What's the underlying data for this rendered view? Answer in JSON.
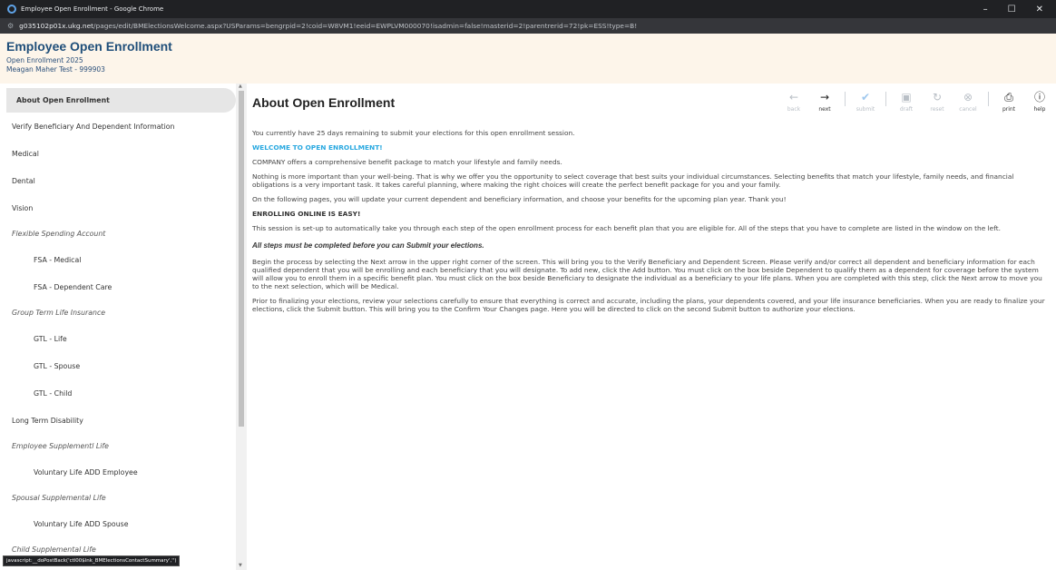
{
  "browser": {
    "window_title": "Employee Open Enrollment - Google Chrome",
    "url_host": "g035102p01x.ukg.net",
    "url_path": "/pages/edit/BMElectionsWelcome.aspx?USParams=bengrpid=2!coid=W8VM1!eeid=EWPLVM000070!isadmin=false!masterid=2!parentrerid=72!pk=ESS!type=B!",
    "status_link": "javascript:__doPostBack('ctl00$lnk_BMElectionsContactSummary','')"
  },
  "header": {
    "title": "Employee Open Enrollment",
    "session": "Open Enrollment 2025",
    "employee": "Meagan Maher Test - 999903"
  },
  "sidebar": {
    "items": [
      {
        "label": "About Open Enrollment"
      },
      {
        "label": "Verify Beneficiary And Dependent Information"
      },
      {
        "label": "Medical"
      },
      {
        "label": "Dental"
      },
      {
        "label": "Vision"
      },
      {
        "label": "Flexible Spending Account"
      },
      {
        "label": "FSA - Medical"
      },
      {
        "label": "FSA - Dependent Care"
      },
      {
        "label": "Group Term Life Insurance"
      },
      {
        "label": "GTL - Life"
      },
      {
        "label": "GTL - Spouse"
      },
      {
        "label": "GTL - Child"
      },
      {
        "label": "Long Term Disability"
      },
      {
        "label": "Employee Supplementl Life"
      },
      {
        "label": "Voluntary Life ADD Employee"
      },
      {
        "label": "Spousal Supplemental Life"
      },
      {
        "label": "Voluntary Life ADD Spouse"
      },
      {
        "label": "Child Supplemental Life"
      }
    ]
  },
  "toolbar": {
    "back": "back",
    "next": "next",
    "submit": "submit",
    "draft": "draft",
    "reset": "reset",
    "cancel": "cancel",
    "print": "print",
    "help": "help"
  },
  "content": {
    "title": "About Open Enrollment",
    "remaining": "You currently have 25 days remaining to submit your elections for this open enrollment session.",
    "welcome": "WELCOME TO OPEN ENROLLMENT!",
    "p1": "COMPANY offers a comprehensive benefit package to match your lifestyle and family needs.",
    "p2": "Nothing is more important than your well-being. That is why we offer you the opportunity to select coverage that best suits your individual circumstances. Selecting benefits that match your lifestyle, family needs, and financial obligations is a very important task. It takes careful planning, where making the right choices will create the perfect benefit package for you and your family.",
    "p3": "On the following pages, you will update your current dependent and beneficiary information, and choose your benefits for the upcoming plan year. Thank you!",
    "easy": "ENROLLING ONLINE IS EASY!",
    "p4": "This session is set-up to automatically take you through each step of the open enrollment process for each benefit plan that you are eligible for. All of the steps that you have to complete are listed in the window on the left.",
    "steps": "All steps must be completed before you can Submit your elections.",
    "p5": "Begin the process by selecting the Next arrow in the upper right corner of the screen. This will bring you to the Verify Beneficiary and Dependent Screen. Please verify and/or correct all dependent and beneficiary information for each qualified dependent that you will be enrolling and each beneficiary that you will designate. To add new, click the Add button. You must click on the box beside Dependent to qualify them as a dependent for coverage before the system will allow you to enroll them in a specific benefit plan. You must click on the box beside Beneficiary to designate the individual as a beneficiary to your life plans. When you are completed with this step, click the Next arrow to move you to the next selection, which will be Medical.",
    "p6": "Prior to finalizing your elections, review your selections carefully to ensure that everything is correct and accurate, including the plans, your dependents covered, and your life insurance beneficiaries. When you are ready to finalize your elections, click the Submit button. This will bring you to the Confirm Your Changes page. Here you will be directed to click on the second Submit button to authorize your elections."
  }
}
